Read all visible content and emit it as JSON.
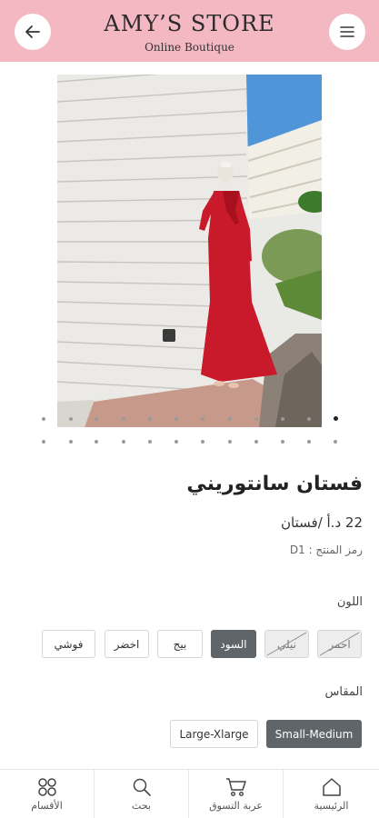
{
  "header": {
    "title": "AMY’S STORE",
    "subtitle": "Online Boutique"
  },
  "product": {
    "image_alt": "woman in red maxi dress",
    "name": "فستان سانتوريني",
    "price": "22 د.أ /فستان",
    "code": "رمز المنتج : D1"
  },
  "options": {
    "color_label": "اللون",
    "colors": [
      {
        "label": "احمر",
        "state": "unavailable"
      },
      {
        "label": "نيلي",
        "state": "unavailable"
      },
      {
        "label": "السود",
        "state": "selected"
      },
      {
        "label": "بيج",
        "state": "available"
      },
      {
        "label": "اخضر",
        "state": "available"
      },
      {
        "label": "فوشي",
        "state": "available"
      }
    ],
    "size_label": "المقاس",
    "sizes": [
      {
        "label": "Small-Medium",
        "state": "selected"
      },
      {
        "label": "Large-Xlarge",
        "state": "available"
      }
    ]
  },
  "carousel": {
    "active_index": 0
  },
  "bottom_nav": [
    {
      "label": "الرئيسية",
      "icon": "home-icon"
    },
    {
      "label": "عربة التسوق",
      "icon": "cart-icon"
    },
    {
      "label": "بحث",
      "icon": "search-icon"
    },
    {
      "label": "الأقسام",
      "icon": "categories-icon"
    }
  ],
  "colors": {
    "header_bg": "#f4b8c2",
    "selected_chip": "#5f6568",
    "dress_red": "#c81a2a"
  }
}
